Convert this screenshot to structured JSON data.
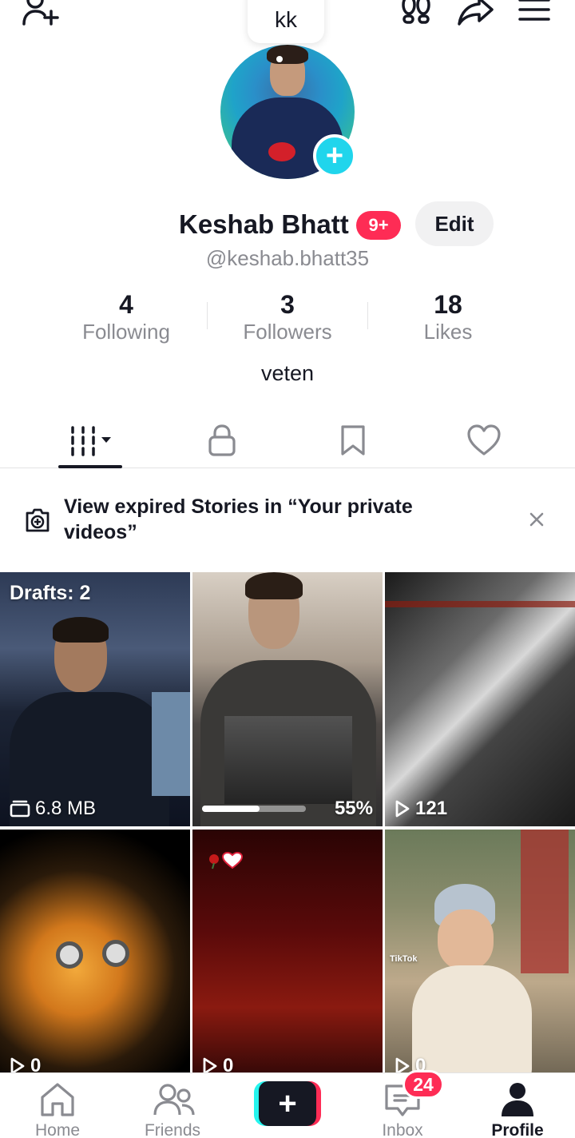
{
  "header": {
    "note_text": "kk"
  },
  "profile": {
    "name": "Keshab Bhatt",
    "notification_badge": "9+",
    "edit_label": "Edit",
    "handle": "@keshab.bhatt35",
    "bio": "veten",
    "stats": [
      {
        "value": "4",
        "label": "Following"
      },
      {
        "value": "3",
        "label": "Followers"
      },
      {
        "value": "18",
        "label": "Likes"
      }
    ]
  },
  "tabs": [
    "videos-grid",
    "private",
    "favorites",
    "liked"
  ],
  "banner": {
    "text": "View expired Stories in “Your private videos”"
  },
  "grid": [
    {
      "top_label": "Drafts: 2",
      "bottom_label": "6.8 MB",
      "bottom_icon": "folder-icon"
    },
    {
      "progress_percent": 55,
      "progress_label": "55%"
    },
    {
      "views": "121"
    },
    {
      "views": "0"
    },
    {
      "views": "0"
    },
    {
      "views": "0",
      "watermark": "TikTok"
    }
  ],
  "nav": {
    "items": [
      {
        "label": "Home"
      },
      {
        "label": "Friends"
      },
      {
        "label": "+"
      },
      {
        "label": "Inbox",
        "badge": "24"
      },
      {
        "label": "Profile"
      }
    ]
  },
  "colors": {
    "accent_red": "#fe2c55",
    "accent_cyan": "#20d5ec",
    "text_primary": "#161823",
    "text_secondary": "#8a8b91"
  }
}
